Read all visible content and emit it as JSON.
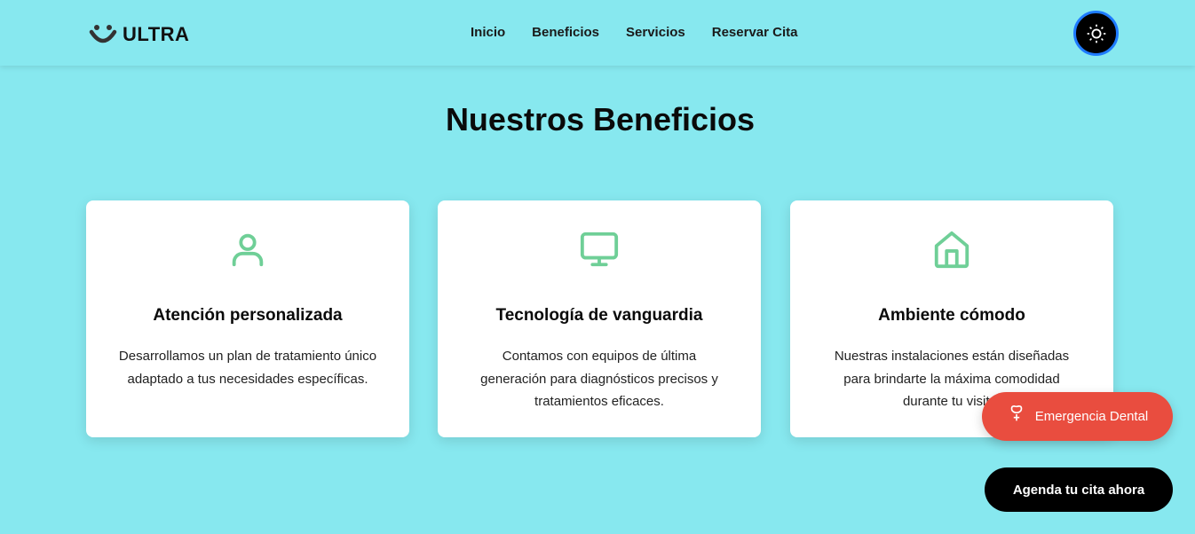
{
  "header": {
    "logo_text": "ULTRA",
    "nav": [
      "Inicio",
      "Beneficios",
      "Servicios",
      "Reservar Cita"
    ],
    "theme_toggle_icon": "sun-icon"
  },
  "main": {
    "title": "Nuestros Beneficios",
    "cards": [
      {
        "icon": "user-icon",
        "title": "Atención personalizada",
        "description": "Desarrollamos un plan de tratamiento único adaptado a tus necesidades específicas."
      },
      {
        "icon": "monitor-icon",
        "title": "Tecnología de vanguardia",
        "description": "Contamos con equipos de última generación para diagnósticos precisos y tratamientos eficaces."
      },
      {
        "icon": "home-icon",
        "title": "Ambiente cómodo",
        "description": "Nuestras instalaciones están diseñadas para brindarte la máxima comodidad durante tu visita."
      }
    ]
  },
  "floating": {
    "emergency_label": "Emergencia Dental",
    "cta_label": "Agenda tu cita ahora"
  },
  "colors": {
    "background": "#87e8ef",
    "icon_green": "#6fcf97",
    "emergency_red": "#e94d3f",
    "toggle_border": "#1e7bff"
  }
}
